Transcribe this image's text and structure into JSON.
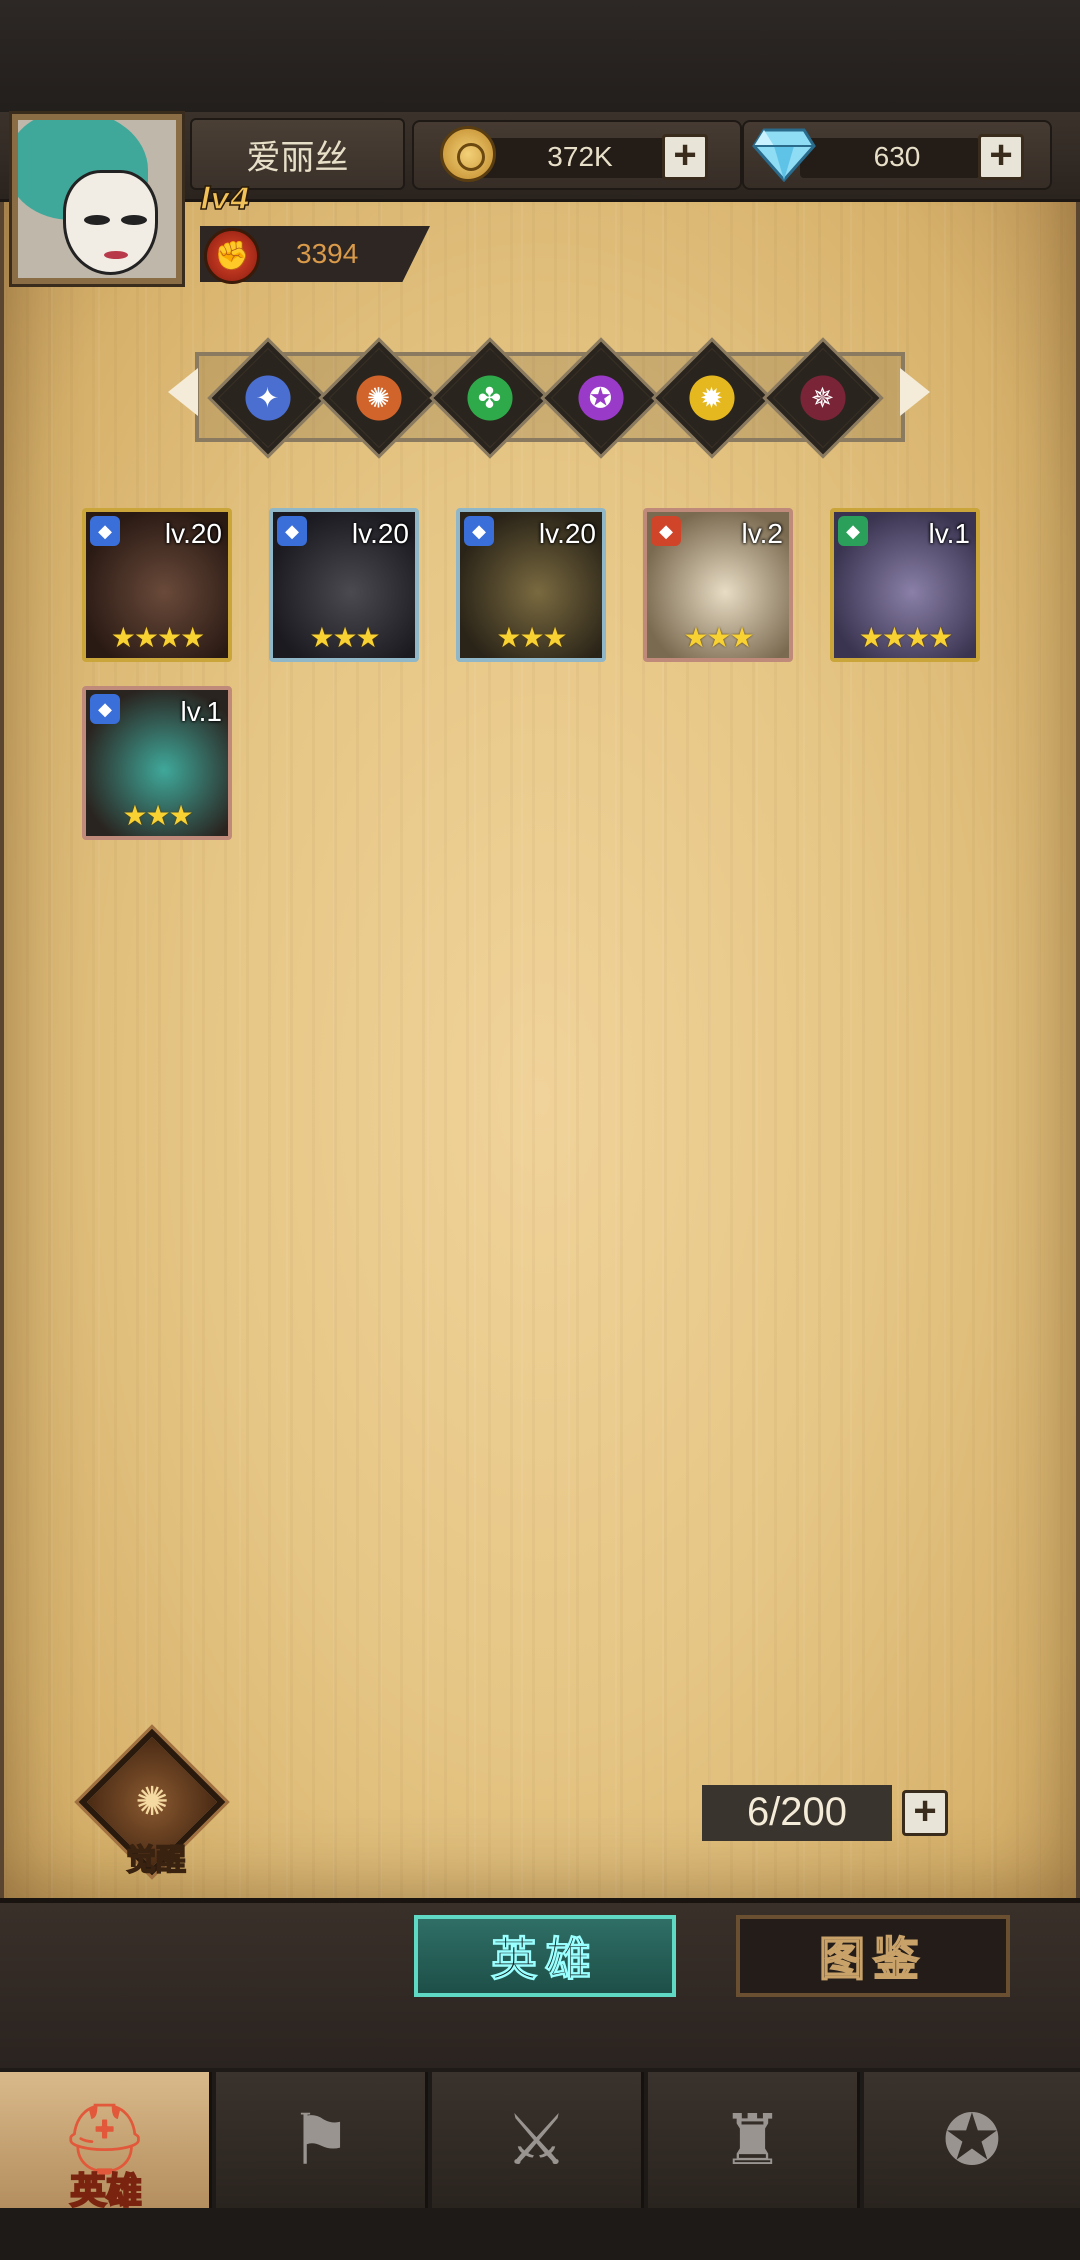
{
  "player": {
    "name": "爱丽丝",
    "level": "lv4",
    "power": "3394"
  },
  "resources": {
    "gold": "372K",
    "gems": "630"
  },
  "factions": [
    {
      "name": "light-faction",
      "color": "#4a6fd0",
      "glyph": "✦"
    },
    {
      "name": "fire-faction",
      "color": "#d0642a",
      "glyph": "✺"
    },
    {
      "name": "nature-faction",
      "color": "#2faa4a",
      "glyph": "✤"
    },
    {
      "name": "arcane-faction",
      "color": "#9a3ac8",
      "glyph": "✪"
    },
    {
      "name": "sun-faction",
      "color": "#e6b820",
      "glyph": "✹"
    },
    {
      "name": "dark-faction",
      "color": "#7a2438",
      "glyph": "✵"
    }
  ],
  "heroes": [
    {
      "level": "lv.20",
      "stars": "★★★★",
      "frame": "gold",
      "class_color": "#3a6ed8"
    },
    {
      "level": "lv.20",
      "stars": "★★★",
      "frame": "silver",
      "class_color": "#3a6ed8"
    },
    {
      "level": "lv.20",
      "stars": "★★★",
      "frame": "silver",
      "class_color": "#3a6ed8"
    },
    {
      "level": "lv.2",
      "stars": "★★★",
      "frame": "bronze",
      "class_color": "#d0442a"
    },
    {
      "level": "lv.1",
      "stars": "★★★★",
      "frame": "gold",
      "class_color": "#2aa05a"
    },
    {
      "level": "lv.1",
      "stars": "★★★",
      "frame": "bronze",
      "class_color": "#3a6ed8"
    }
  ],
  "awaken_label": "觉醒",
  "hero_count": "6/200",
  "sub_tabs": {
    "heroes": "英雄",
    "codex": "图鉴"
  },
  "nav": {
    "heroes_label": "英雄"
  }
}
